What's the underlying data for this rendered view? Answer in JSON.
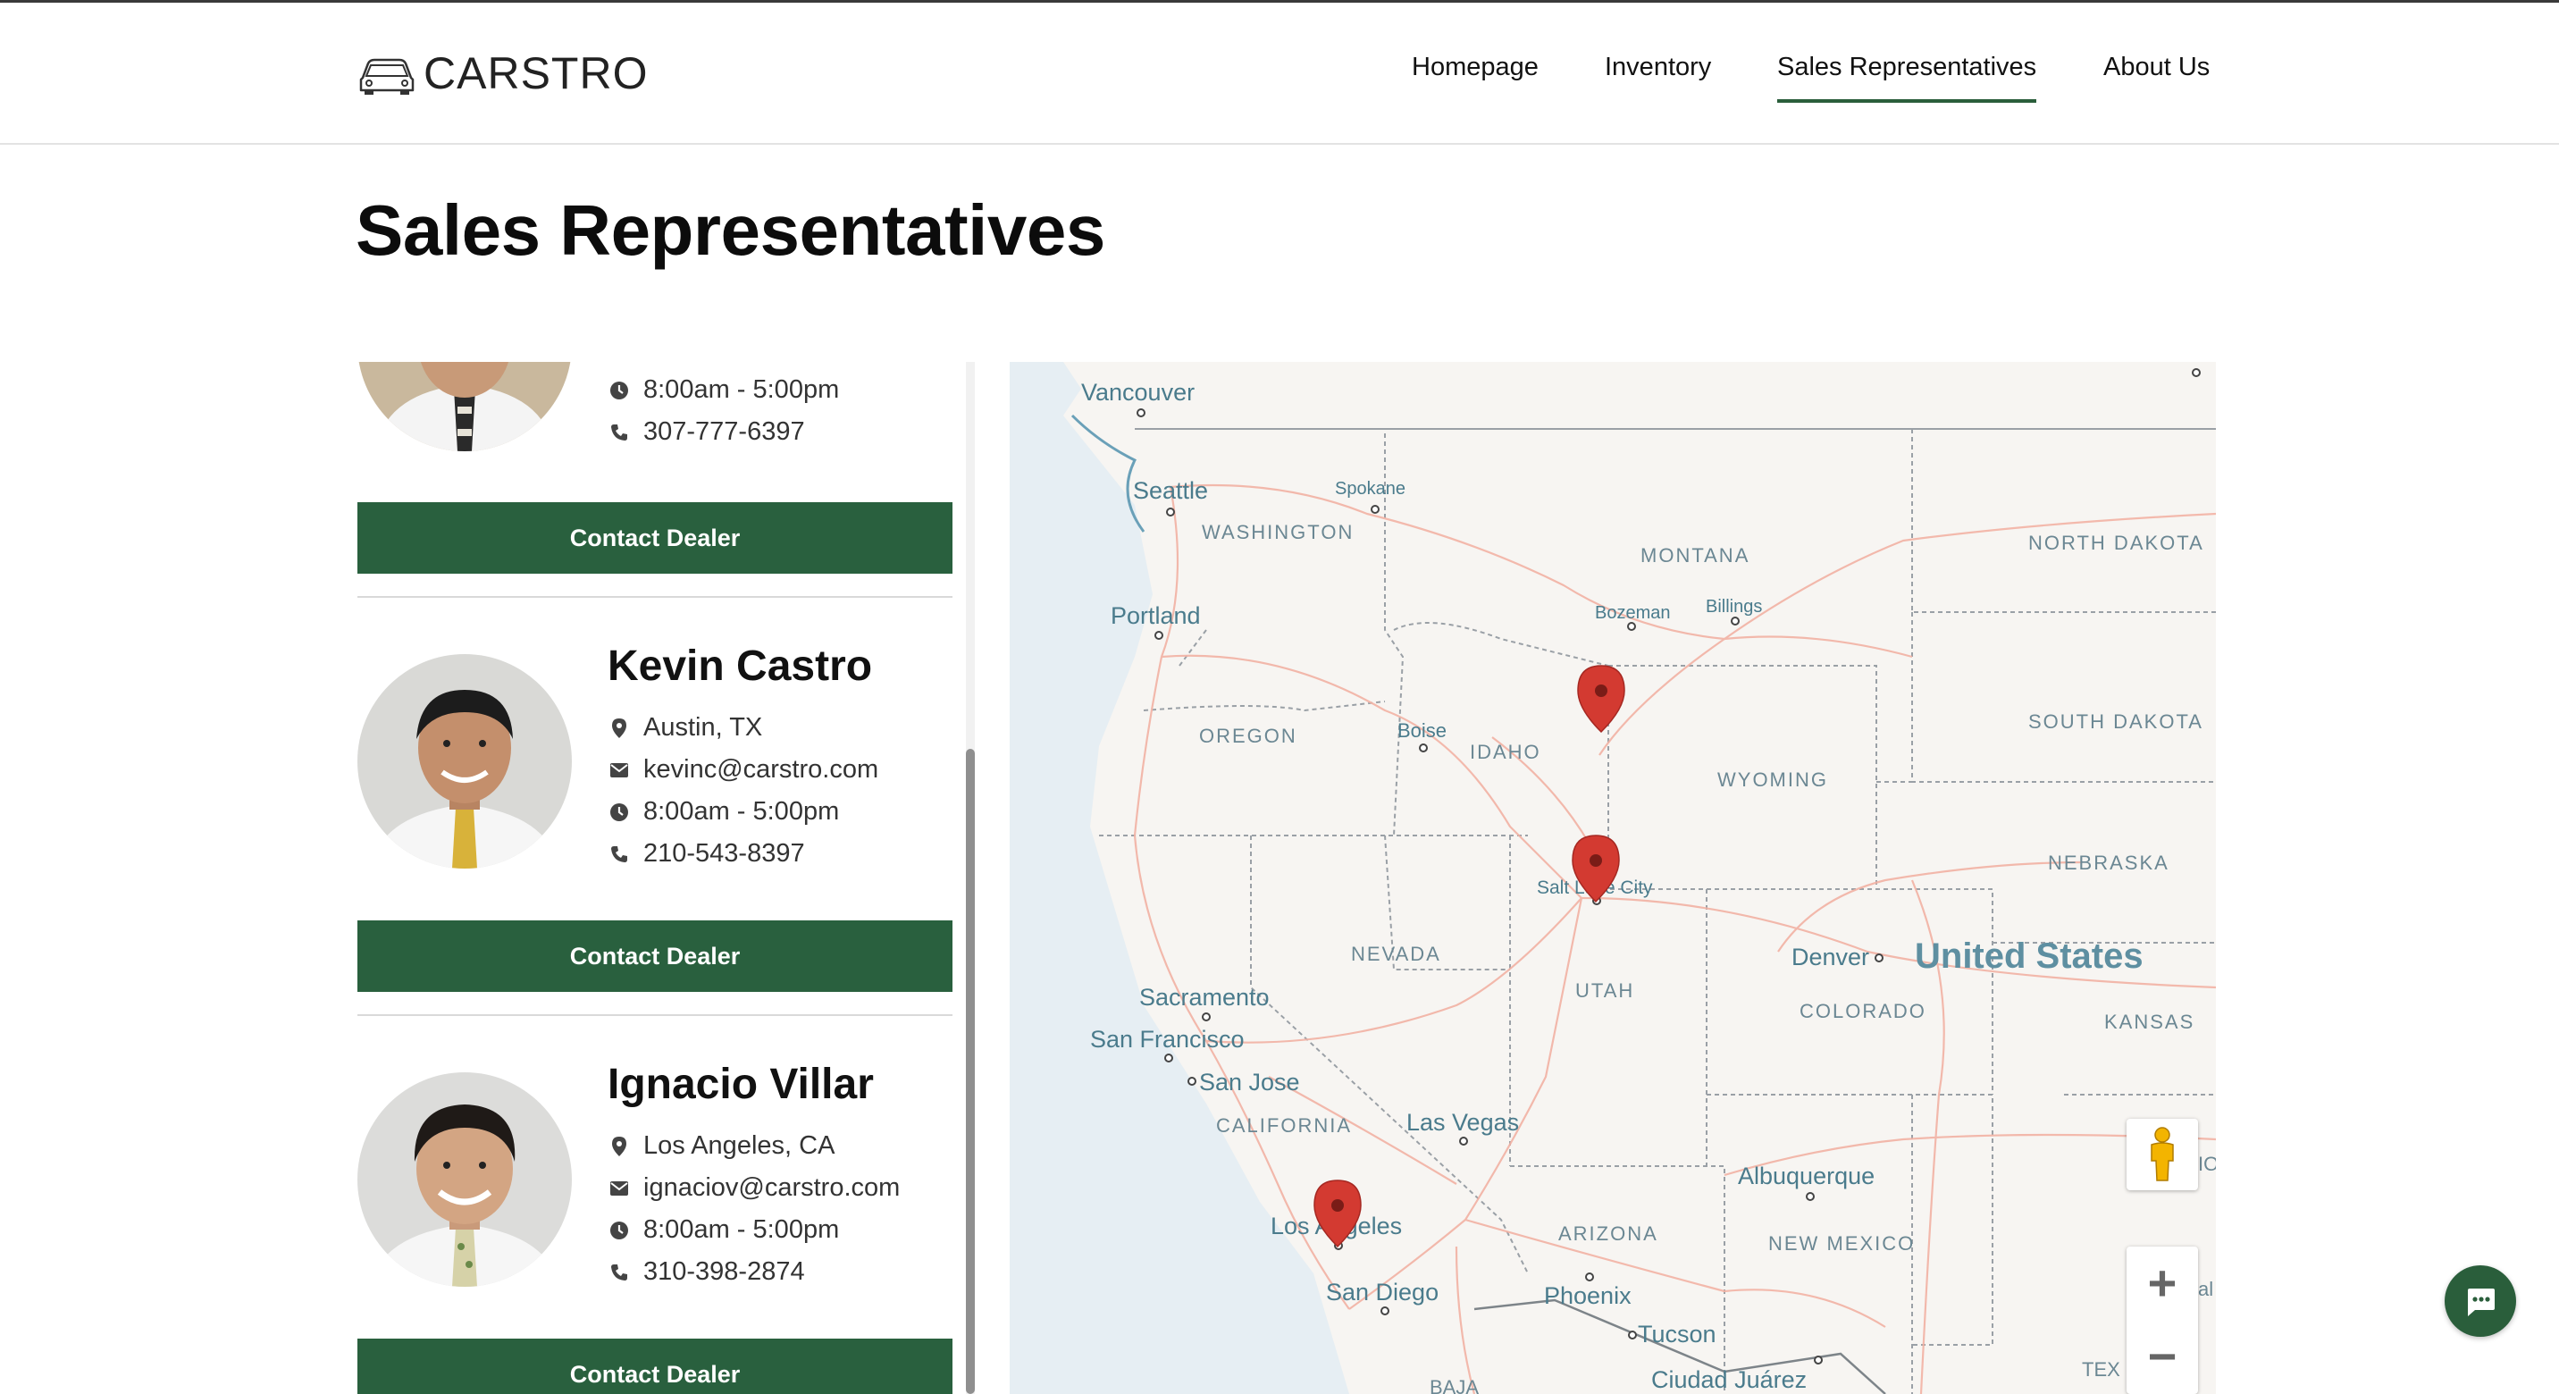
{
  "brand": {
    "name": "CARSTRO",
    "logo_icon": "car-icon",
    "accent_color": "#29603e"
  },
  "nav": {
    "items": [
      {
        "label": "Homepage",
        "active": false
      },
      {
        "label": "Inventory",
        "active": false
      },
      {
        "label": "Sales Representatives",
        "active": true
      },
      {
        "label": "About Us",
        "active": false
      }
    ]
  },
  "page": {
    "title": "Sales Representatives"
  },
  "reps": [
    {
      "name": "",
      "location": "",
      "email": "",
      "hours": "8:00am - 5:00pm",
      "phone": "307-777-6397",
      "button": "Contact Dealer"
    },
    {
      "name": "Kevin Castro",
      "location": "Austin, TX",
      "email": "kevinc@carstro.com",
      "hours": "8:00am - 5:00pm",
      "phone": "210-543-8397",
      "button": "Contact Dealer"
    },
    {
      "name": "Ignacio Villar",
      "location": "Los Angeles, CA",
      "email": "ignaciov@carstro.com",
      "hours": "8:00am - 5:00pm",
      "phone": "310-398-2874",
      "button": "Contact Dealer"
    }
  ],
  "map": {
    "cities": [
      "Vancouver",
      "Seattle",
      "Spokane",
      "Portland",
      "Bozeman",
      "Billings",
      "Boise",
      "Salt Lake City",
      "Denver",
      "Sacramento",
      "San Francisco",
      "San Jose",
      "Las Vegas",
      "Los Angeles",
      "San Diego",
      "Phoenix",
      "Tucson",
      "Albuquerque",
      "Ciudad Juárez"
    ],
    "states": [
      "WASHINGTON",
      "MONTANA",
      "NORTH DAKOTA",
      "SOUTH DAKOTA",
      "OREGON",
      "IDAHO",
      "WYOMING",
      "NEBRASKA",
      "NEVADA",
      "UTAH",
      "COLORADO",
      "KANSAS",
      "CALIFORNIA",
      "ARIZONA",
      "NEW MEXICO"
    ],
    "country": "United States",
    "partial_labels": [
      "IO",
      "al",
      "TEX",
      "BAJA"
    ],
    "zoom_in": "+",
    "zoom_out": "−",
    "marker_color": "#d33a31",
    "icons": [
      "pegman-icon",
      "map-marker-icon"
    ]
  },
  "chat": {
    "icon": "chat-icon"
  }
}
